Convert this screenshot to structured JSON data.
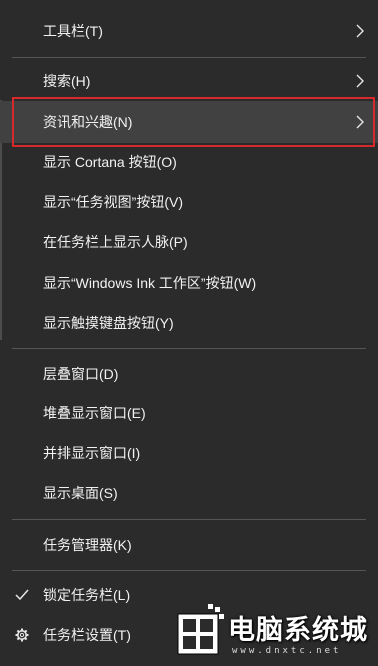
{
  "menu": {
    "items": [
      {
        "label": "工具栏(T)"
      },
      {
        "label": "搜索(H)"
      },
      {
        "label": "资讯和兴趣(N)"
      },
      {
        "label": "显示 Cortana 按钮(O)"
      },
      {
        "label": "显示“任务视图”按钮(V)"
      },
      {
        "label": "在任务栏上显示人脉(P)"
      },
      {
        "label": "显示“Windows Ink 工作区”按钮(W)"
      },
      {
        "label": "显示触摸键盘按钮(Y)"
      },
      {
        "label": "层叠窗口(D)"
      },
      {
        "label": "堆叠显示窗口(E)"
      },
      {
        "label": "并排显示窗口(I)"
      },
      {
        "label": "显示桌面(S)"
      },
      {
        "label": "任务管理器(K)"
      },
      {
        "label": "锁定任务栏(L)"
      },
      {
        "label": "任务栏设置(T)"
      }
    ],
    "highlighted_item": "资讯和兴趣(N)",
    "checked_item": "锁定任务栏(L)",
    "highlight_border_color": "#d7282c"
  },
  "watermark": {
    "title": "电脑系统城",
    "url": "www.dnxtc.net"
  }
}
